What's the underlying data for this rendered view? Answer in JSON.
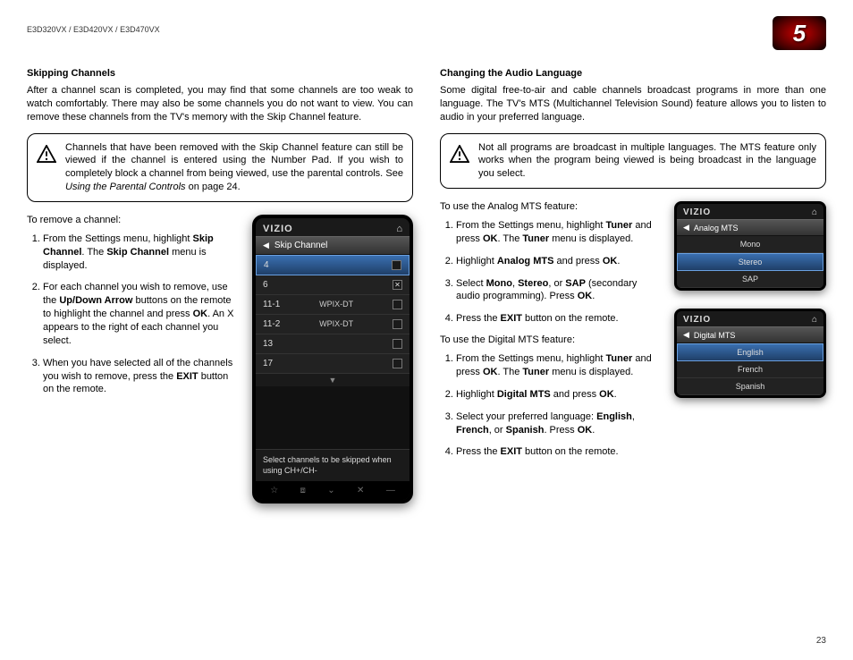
{
  "header": {
    "model": "E3D320VX / E3D420VX / E3D470VX",
    "chapter": "5"
  },
  "page_number": "23",
  "left": {
    "title": "Skipping Channels",
    "intro": "After a channel scan is completed, you may find that some channels are too weak to watch comfortably. There may also be some channels you do not want to view. You can remove these channels from the TV's memory with the Skip Channel feature.",
    "note_pre": "Channels that have been removed with the Skip Channel feature can still be viewed if the channel is entered using the Number Pad. If you wish to completely block a channel from being viewed, use the parental controls. See ",
    "note_link": "Using the Parental Controls",
    "note_post": " on page 24.",
    "remove_intro": "To remove a channel:",
    "steps": {
      "s1a": "From the Settings menu, highlight ",
      "s1b": "Skip Channel",
      "s1c": ". The ",
      "s1d": "Skip Channel",
      "s1e": " menu is displayed.",
      "s2a": "For each channel you wish to remove, use the ",
      "s2b": "Up/Down Arrow",
      "s2c": " buttons on the remote to highlight the channel and press ",
      "s2d": "OK",
      "s2e": ". An X appears to the right of each channel you select.",
      "s3a": "When you have selected all of the channels you wish to remove, press the ",
      "s3b": "EXIT",
      "s3c": " button on the remote."
    },
    "phone": {
      "logo": "VIZIO",
      "title": "Skip Channel",
      "rows": [
        {
          "ch": "4",
          "name": "",
          "x": false
        },
        {
          "ch": "6",
          "name": "",
          "x": true
        },
        {
          "ch": "11-1",
          "name": "WPIX-DT",
          "x": false
        },
        {
          "ch": "11-2",
          "name": "WPIX-DT",
          "x": false
        },
        {
          "ch": "13",
          "name": "",
          "x": false
        },
        {
          "ch": "17",
          "name": "",
          "x": false
        }
      ],
      "help": "Select channels to be skipped when using CH+/CH-",
      "bottom": [
        "☆",
        "⧈",
        "⌄",
        "✕",
        "—"
      ]
    }
  },
  "right": {
    "title": "Changing the Audio Language",
    "intro": "Some digital free-to-air and cable channels broadcast programs in more than one language. The TV's MTS (Multichannel Television Sound) feature allows you to listen to audio in your preferred language.",
    "note": "Not all programs are broadcast in multiple languages. The MTS feature only works when the program being viewed is being broadcast in the language you select.",
    "analog_intro": "To use the Analog MTS feature:",
    "analog_steps": {
      "s1a": "From the Settings menu, highlight ",
      "s1b": "Tuner",
      "s1c": " and press ",
      "s1d": "OK",
      "s1e": ". The ",
      "s1f": "Tuner",
      "s1g": " menu is displayed.",
      "s2a": "Highlight ",
      "s2b": "Analog MTS",
      "s2c": " and press ",
      "s2d": "OK",
      "s2e": ".",
      "s3a": "Select ",
      "s3b": "Mono",
      "s3c": ", ",
      "s3d": "Stereo",
      "s3e": ", or ",
      "s3f": "SAP",
      "s3g": " (secondary audio programming). Press ",
      "s3h": "OK",
      "s3i": ".",
      "s4a": "Press the ",
      "s4b": "EXIT",
      "s4c": " button on the remote."
    },
    "digital_intro": "To use the Digital MTS feature:",
    "digital_steps": {
      "s1a": "From the Settings menu, highlight ",
      "s1b": "Tuner",
      "s1c": " and press ",
      "s1d": "OK",
      "s1e": ". The ",
      "s1f": "Tuner",
      "s1g": " menu is displayed.",
      "s2a": "Highlight ",
      "s2b": "Digital MTS",
      "s2c": " and press ",
      "s2d": "OK",
      "s2e": ".",
      "s3a": "Select your preferred language: ",
      "s3b": "English",
      "s3c": ", ",
      "s3d": "French",
      "s3e": ", or ",
      "s3f": "Spanish",
      "s3g": ". Press ",
      "s3h": "OK",
      "s3i": ".",
      "s4a": "Press the ",
      "s4b": "EXIT",
      "s4c": " button on the remote."
    },
    "mini_analog": {
      "logo": "VIZIO",
      "title": "Analog MTS",
      "rows": [
        "Mono",
        "Stereo",
        "SAP"
      ],
      "sel": 1
    },
    "mini_digital": {
      "logo": "VIZIO",
      "title": "Digital MTS",
      "rows": [
        "English",
        "French",
        "Spanish"
      ],
      "sel": 0
    }
  }
}
